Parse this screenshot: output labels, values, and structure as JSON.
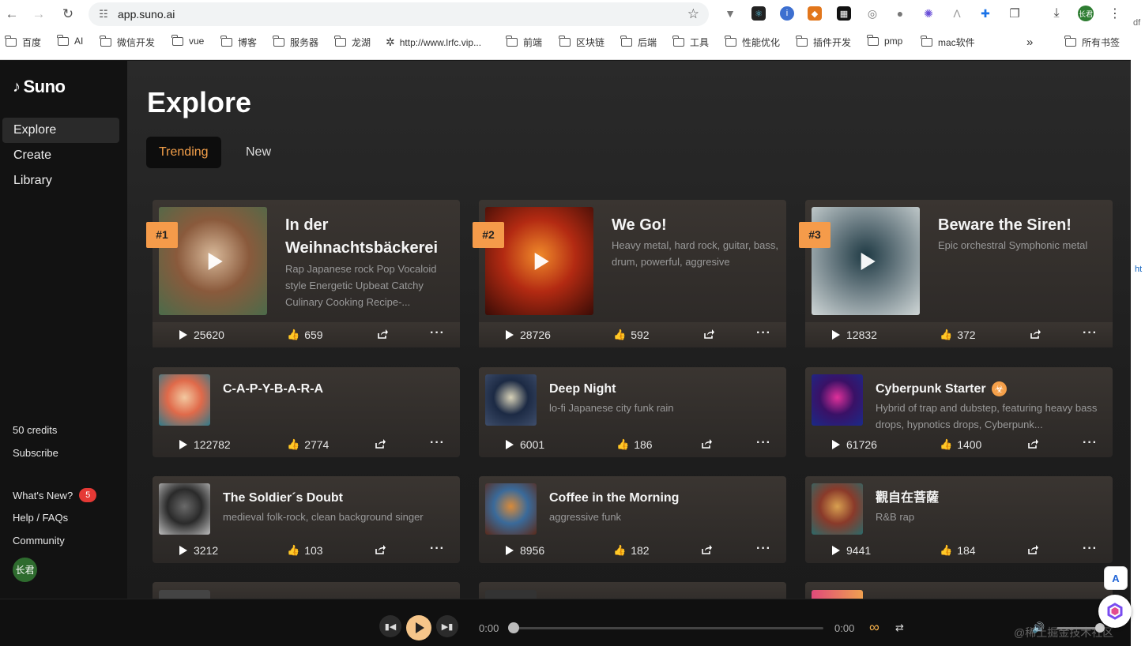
{
  "browser": {
    "url": "app.suno.ai",
    "profile_label": "长君",
    "bookmarks": [
      "百度",
      "AI",
      "微信开发",
      "vue",
      "博客",
      "服务器",
      "龙湖",
      "http://www.lrfc.vip...",
      "前端",
      "区块链",
      "后端",
      "工具",
      "性能优化",
      "插件开发",
      "pmp",
      "mac软件"
    ],
    "all_bookmarks": "所有书签",
    "more": "»"
  },
  "sidebar": {
    "logo": "Suno",
    "nav": [
      "Explore",
      "Create",
      "Library"
    ],
    "credits": "50 credits",
    "subscribe": "Subscribe",
    "whats_new": "What's New?",
    "whats_new_count": "5",
    "help": "Help / FAQs",
    "community": "Community",
    "avatar": "长君"
  },
  "main": {
    "title": "Explore",
    "tabs": [
      "Trending",
      "New"
    ],
    "featured": [
      {
        "rank": "#1",
        "title": "In der Weihnachtsbäckerei",
        "desc": "Rap Japanese rock Pop Vocaloid style Energetic Upbeat Catchy Culinary Cooking Recipe-...",
        "plays": "25620",
        "likes": "659",
        "thumb_colors": [
          "#8a5a3c",
          "#d8b99a",
          "#4b6b4a"
        ]
      },
      {
        "rank": "#2",
        "title": "We Go!",
        "desc": "Heavy metal, hard rock, guitar, bass, drum, powerful, aggresive",
        "plays": "28726",
        "likes": "592",
        "thumb_colors": [
          "#b32a12",
          "#f08a2a",
          "#3a0c06"
        ]
      },
      {
        "rank": "#3",
        "title": "Beware the Siren!",
        "desc": "Epic orchestral Symphonic metal",
        "plays": "12832",
        "likes": "372",
        "thumb_colors": [
          "#6e7f86",
          "#1f3a44",
          "#cfd6d6"
        ]
      }
    ],
    "songs": [
      {
        "title": "C-A-P-Y-B-A-R-A",
        "desc": "",
        "plays": "122782",
        "likes": "2774",
        "thumb_colors": [
          "#e06a4a",
          "#f2c8a0",
          "#2f7a8a"
        ]
      },
      {
        "title": "Deep Night",
        "desc": "lo-fi Japanese city funk rain",
        "plays": "6001",
        "likes": "186",
        "thumb_colors": [
          "#1c2a44",
          "#d8d2b8",
          "#3f4e6b"
        ]
      },
      {
        "title": "Cyberpunk Starter",
        "title_emoji": "☣",
        "desc": "Hybrid of trap and dubstep, featuring heavy bass drops, hypnotics drops, Cyberpunk...",
        "plays": "61726",
        "likes": "1400",
        "thumb_colors": [
          "#3a1166",
          "#e0309a",
          "#1a2a88"
        ]
      },
      {
        "title": "The Soldier´s Doubt",
        "desc": "medieval folk-rock, clean background singer",
        "plays": "3212",
        "likes": "103",
        "thumb_colors": [
          "#2a2a2a",
          "#6a6a6a",
          "#bdbdbd"
        ]
      },
      {
        "title": "Coffee in the Morning",
        "desc": "aggressive funk",
        "plays": "8956",
        "likes": "182",
        "thumb_colors": [
          "#3a6a9a",
          "#d88a3a",
          "#5a2a1a"
        ]
      },
      {
        "title": "觀自在菩薩",
        "desc": "R&B rap",
        "plays": "9441",
        "likes": "184",
        "thumb_colors": [
          "#8a3a2a",
          "#d8a050",
          "#2a6a6a"
        ]
      }
    ]
  },
  "player": {
    "current_time": "0:00",
    "duration": "0:00",
    "progress": 0,
    "volume": 0.85
  },
  "overlay": {
    "watermark": "@稀土掘金技术社区",
    "edge_text_top": "df",
    "edge_text_mid": "ht"
  }
}
